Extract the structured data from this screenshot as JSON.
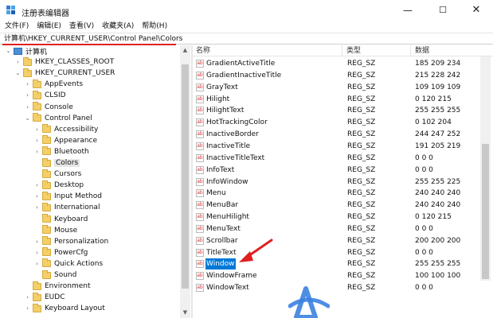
{
  "window": {
    "title": "注册表编辑器"
  },
  "menu": [
    "文件(F)",
    "编辑(E)",
    "查看(V)",
    "收藏夹(A)",
    "帮助(H)"
  ],
  "address": "计算机\\HKEY_CURRENT_USER\\Control Panel\\Colors",
  "tree": [
    {
      "label": "计算机",
      "expander": "⌄",
      "icon": "computer-icon"
    },
    {
      "label": "HKEY_CLASSES_ROOT",
      "expander": "›",
      "icon": "folder-icon"
    },
    {
      "label": "HKEY_CURRENT_USER",
      "expander": "⌄",
      "icon": "folder-icon"
    },
    {
      "label": "AppEvents",
      "expander": "›",
      "icon": "folder-icon"
    },
    {
      "label": "CLSID",
      "expander": "›",
      "icon": "folder-icon"
    },
    {
      "label": "Console",
      "expander": "›",
      "icon": "folder-icon"
    },
    {
      "label": "Control Panel",
      "expander": "⌄",
      "icon": "folder-icon"
    },
    {
      "label": "Accessibility",
      "expander": "›",
      "icon": "folder-icon"
    },
    {
      "label": "Appearance",
      "expander": "›",
      "icon": "folder-icon"
    },
    {
      "label": "Bluetooth",
      "expander": "›",
      "icon": "folder-icon"
    },
    {
      "label": "Colors",
      "expander": "",
      "icon": "folder-icon",
      "selected": true
    },
    {
      "label": "Cursors",
      "expander": "",
      "icon": "folder-icon"
    },
    {
      "label": "Desktop",
      "expander": "›",
      "icon": "folder-icon"
    },
    {
      "label": "Input Method",
      "expander": "›",
      "icon": "folder-icon"
    },
    {
      "label": "International",
      "expander": "›",
      "icon": "folder-icon"
    },
    {
      "label": "Keyboard",
      "expander": "",
      "icon": "folder-icon"
    },
    {
      "label": "Mouse",
      "expander": "",
      "icon": "folder-icon"
    },
    {
      "label": "Personalization",
      "expander": "›",
      "icon": "folder-icon"
    },
    {
      "label": "PowerCfg",
      "expander": "›",
      "icon": "folder-icon"
    },
    {
      "label": "Quick Actions",
      "expander": "›",
      "icon": "folder-icon"
    },
    {
      "label": "Sound",
      "expander": "",
      "icon": "folder-icon"
    },
    {
      "label": "Environment",
      "expander": "",
      "icon": "folder-icon"
    },
    {
      "label": "EUDC",
      "expander": "›",
      "icon": "folder-icon"
    },
    {
      "label": "Keyboard Layout",
      "expander": "›",
      "icon": "folder-icon"
    }
  ],
  "list": {
    "headers": {
      "name": "名称",
      "type": "类型",
      "data": "数据"
    },
    "rows": [
      {
        "name": "GradientActiveTitle",
        "type": "REG_SZ",
        "data": "185 209 234"
      },
      {
        "name": "GradientInactiveTitle",
        "type": "REG_SZ",
        "data": "215 228 242"
      },
      {
        "name": "GrayText",
        "type": "REG_SZ",
        "data": "109 109 109"
      },
      {
        "name": "Hilight",
        "type": "REG_SZ",
        "data": "0 120 215"
      },
      {
        "name": "HilightText",
        "type": "REG_SZ",
        "data": "255 255 255"
      },
      {
        "name": "HotTrackingColor",
        "type": "REG_SZ",
        "data": "0 102 204"
      },
      {
        "name": "InactiveBorder",
        "type": "REG_SZ",
        "data": "244 247 252"
      },
      {
        "name": "InactiveTitle",
        "type": "REG_SZ",
        "data": "191 205 219"
      },
      {
        "name": "InactiveTitleText",
        "type": "REG_SZ",
        "data": "0 0 0"
      },
      {
        "name": "InfoText",
        "type": "REG_SZ",
        "data": "0 0 0"
      },
      {
        "name": "InfoWindow",
        "type": "REG_SZ",
        "data": "255 255 225"
      },
      {
        "name": "Menu",
        "type": "REG_SZ",
        "data": "240 240 240"
      },
      {
        "name": "MenuBar",
        "type": "REG_SZ",
        "data": "240 240 240"
      },
      {
        "name": "MenuHilight",
        "type": "REG_SZ",
        "data": "0 120 215"
      },
      {
        "name": "MenuText",
        "type": "REG_SZ",
        "data": "0 0 0"
      },
      {
        "name": "Scrollbar",
        "type": "REG_SZ",
        "data": "200 200 200"
      },
      {
        "name": "TitleText",
        "type": "REG_SZ",
        "data": "0 0 0"
      },
      {
        "name": "Window",
        "type": "REG_SZ",
        "data": "255 255 255",
        "highlight": true
      },
      {
        "name": "WindowFrame",
        "type": "REG_SZ",
        "data": "100 100 100"
      },
      {
        "name": "WindowText",
        "type": "REG_SZ",
        "data": "0 0 0"
      }
    ]
  },
  "colors": {
    "selection": "#0078d7",
    "annotation": "#e02020",
    "folder": "#f3cf6a"
  }
}
